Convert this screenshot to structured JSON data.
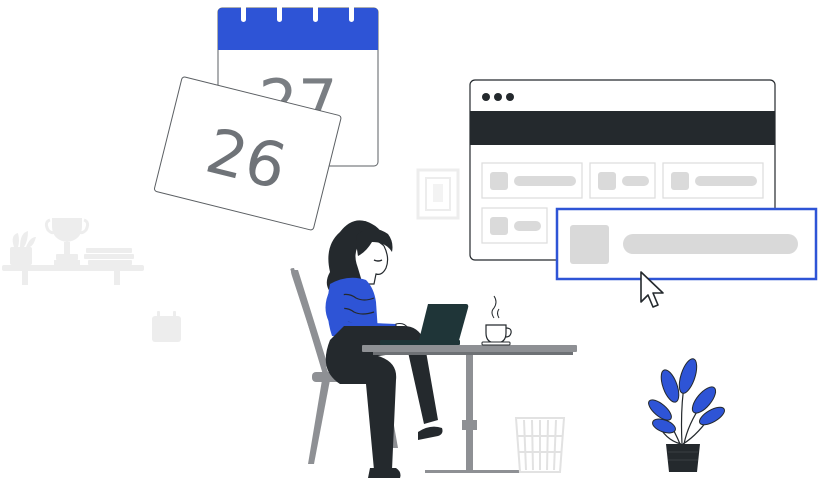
{
  "calendar": {
    "back_date": "27",
    "front_date": "26"
  },
  "colors": {
    "accent": "#2E54D6",
    "dark": "#24292D",
    "gray": "#8E9094",
    "light_gray": "#D9D9D9",
    "faint": "#EDEDED"
  },
  "icons": {
    "cursor": "arrow-cursor-icon",
    "window_dots": "window-controls-icon"
  }
}
